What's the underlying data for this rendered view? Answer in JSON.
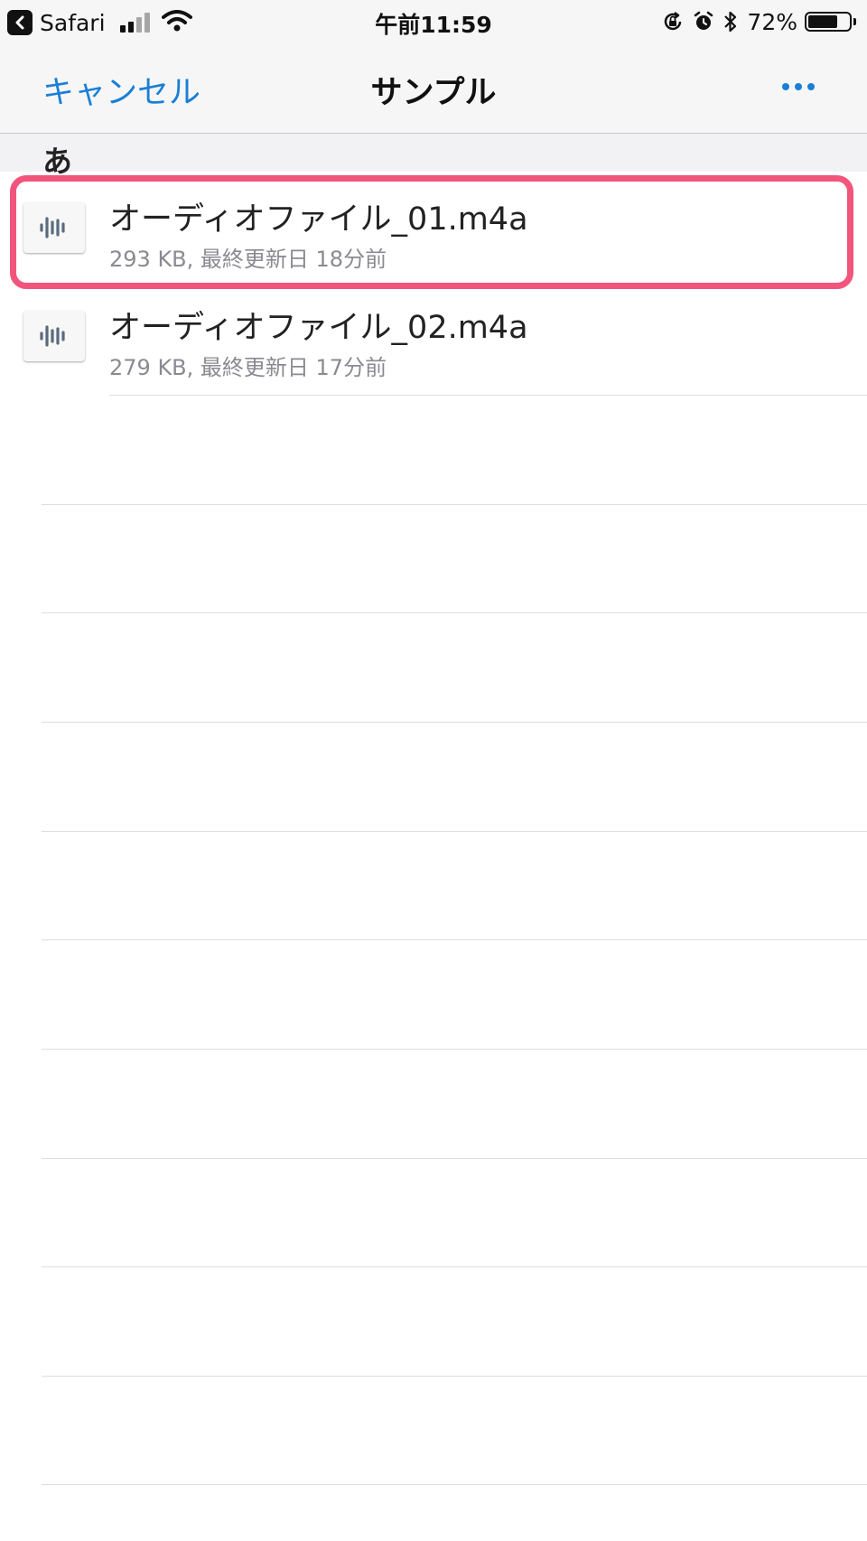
{
  "status_bar": {
    "app_name": "Safari",
    "time": "午前11:59",
    "battery_percent": "72%",
    "battery_level": 0.72
  },
  "nav": {
    "cancel_label": "キャンセル",
    "title": "サンプル"
  },
  "section": {
    "label": "あ"
  },
  "files": [
    {
      "name": "オーディオファイル_01.m4a",
      "meta": "293 KB, 最終更新日 18分前",
      "icon": "audio-waveform-icon",
      "highlighted": true
    },
    {
      "name": "オーディオファイル_02.m4a",
      "meta": "279 KB, 最終更新日 17分前",
      "icon": "audio-waveform-icon",
      "highlighted": false
    }
  ],
  "colors": {
    "accent": "#1a7fd6",
    "highlight": "#f2557c"
  }
}
